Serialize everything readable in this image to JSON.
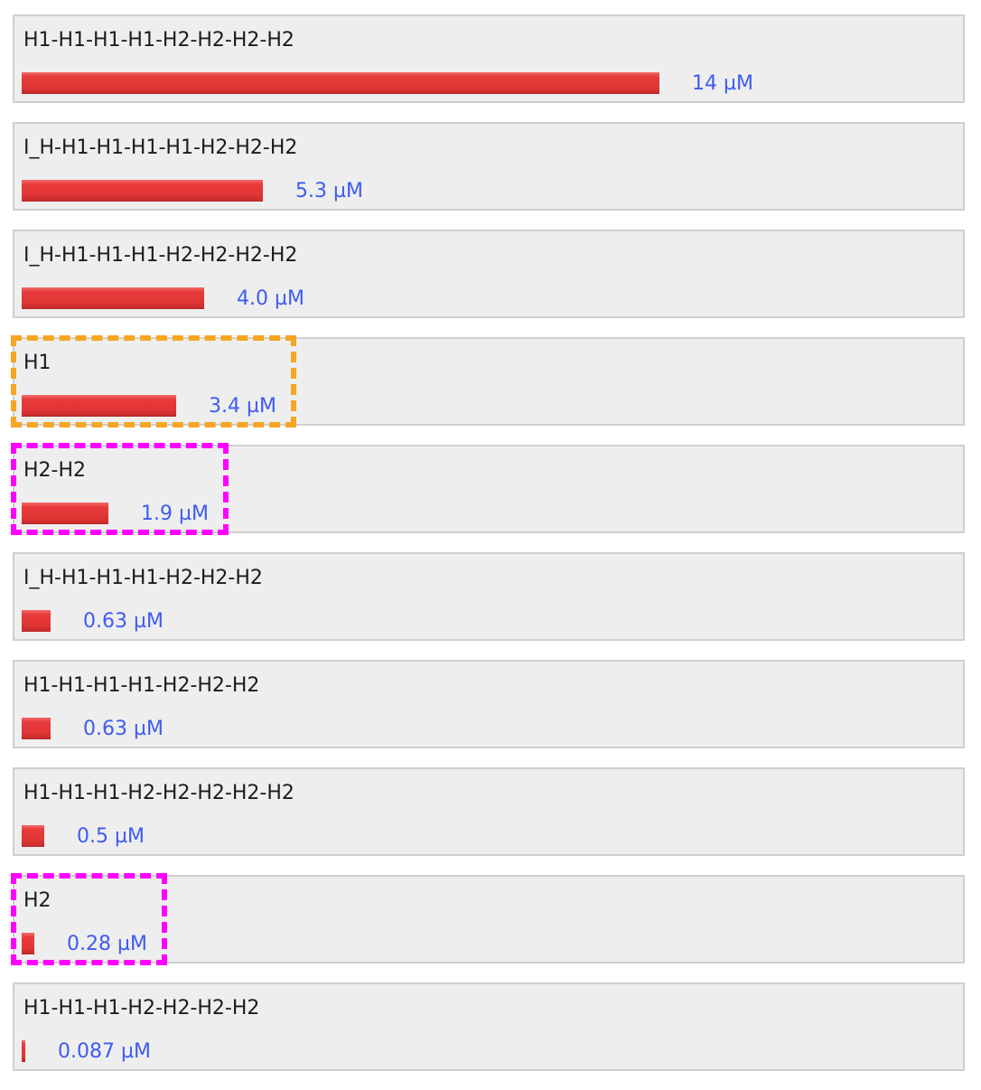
{
  "chart_data": {
    "type": "bar",
    "orientation": "horizontal",
    "categories": [
      "H1-H1-H1-H1-H2-H2-H2-H2",
      "I_H-H1-H1-H1-H1-H2-H2-H2",
      "I_H-H1-H1-H1-H2-H2-H2-H2",
      "H1",
      "H2-H2",
      "I_H-H1-H1-H1-H2-H2-H2",
      "H1-H1-H1-H1-H2-H2-H2",
      "H1-H1-H1-H2-H2-H2-H2-H2",
      "H2",
      "H1-H1-H1-H2-H2-H2-H2"
    ],
    "values": [
      14,
      5.3,
      4.0,
      3.4,
      1.9,
      0.63,
      0.63,
      0.5,
      0.28,
      0.087
    ],
    "value_labels": [
      "14 µM",
      "5.3 µM",
      "4.0 µM",
      "3.4 µM",
      "1.9 µM",
      "0.63 µM",
      "0.63 µM",
      "0.5 µM",
      "0.28 µM",
      "0.087 µM"
    ],
    "unit": "µM",
    "grid": false,
    "bar_color": "#e53e3e",
    "label_color": "#1c1c1c",
    "value_color": "#3f5bf0",
    "panel_background": "#eeeeee",
    "highlights": [
      {
        "category": "H1",
        "color": "#f5a623",
        "style": "dashed"
      },
      {
        "category": "H2-H2",
        "color": "#ff00ff",
        "style": "dashed"
      },
      {
        "category": "H2",
        "color": "#ff00ff",
        "style": "dashed"
      }
    ]
  }
}
